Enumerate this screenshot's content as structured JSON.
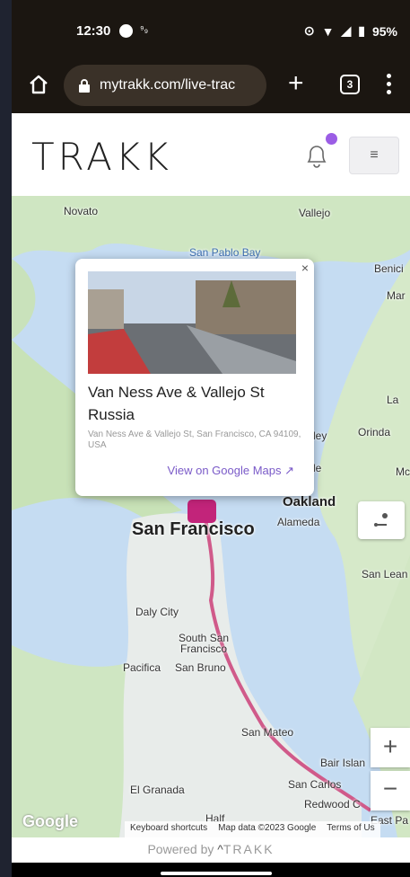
{
  "status": {
    "time": "12:30",
    "icons": "⁹₉",
    "battery": "95%"
  },
  "browser": {
    "url": "mytrakk.com/live-trac",
    "tab_count": "3"
  },
  "header": {
    "logo": "TRAKK",
    "menu_icon": "≡"
  },
  "map": {
    "labels": {
      "novato": "Novato",
      "vallejo": "Vallejo",
      "san_pablo_bay": "San Pablo Bay",
      "benicia": "Benici",
      "martinez": "Mar",
      "orinda": "Orinda",
      "berkeley": "ley",
      "la": "La",
      "mo": "Mc",
      "oakland": "Oakland",
      "alameda": "Alameda",
      "san_francisco": "San Francisco",
      "san_leandro": "San Lean",
      "daly_city": "Daly City",
      "south_sf": "South San\nFrancisco",
      "pacifica": "Pacifica",
      "san_bruno": "San Bruno",
      "san_mateo": "San Mateo",
      "bair_island": "Bair Islan",
      "san_carlos": "San Carlos",
      "el_granada": "El Granada",
      "half": "Half",
      "redwood": "Redwood C",
      "east_pa": "East Pa",
      "le": "le"
    },
    "zoom_in": "+",
    "zoom_out": "−",
    "google": "Google",
    "attribution": {
      "shortcuts": "Keyboard shortcuts",
      "data": "Map data ©2023 Google",
      "terms": "Terms of Us"
    }
  },
  "popup": {
    "close": "×",
    "title": "Van Ness Ave & Vallejo St Russia",
    "address": "Van Ness Ave & Vallejo St, San Francisco, CA 94109, USA",
    "link": "View on Google Maps ↗"
  },
  "footer": {
    "powered": "Powered by ",
    "brand": "TRAKK"
  }
}
